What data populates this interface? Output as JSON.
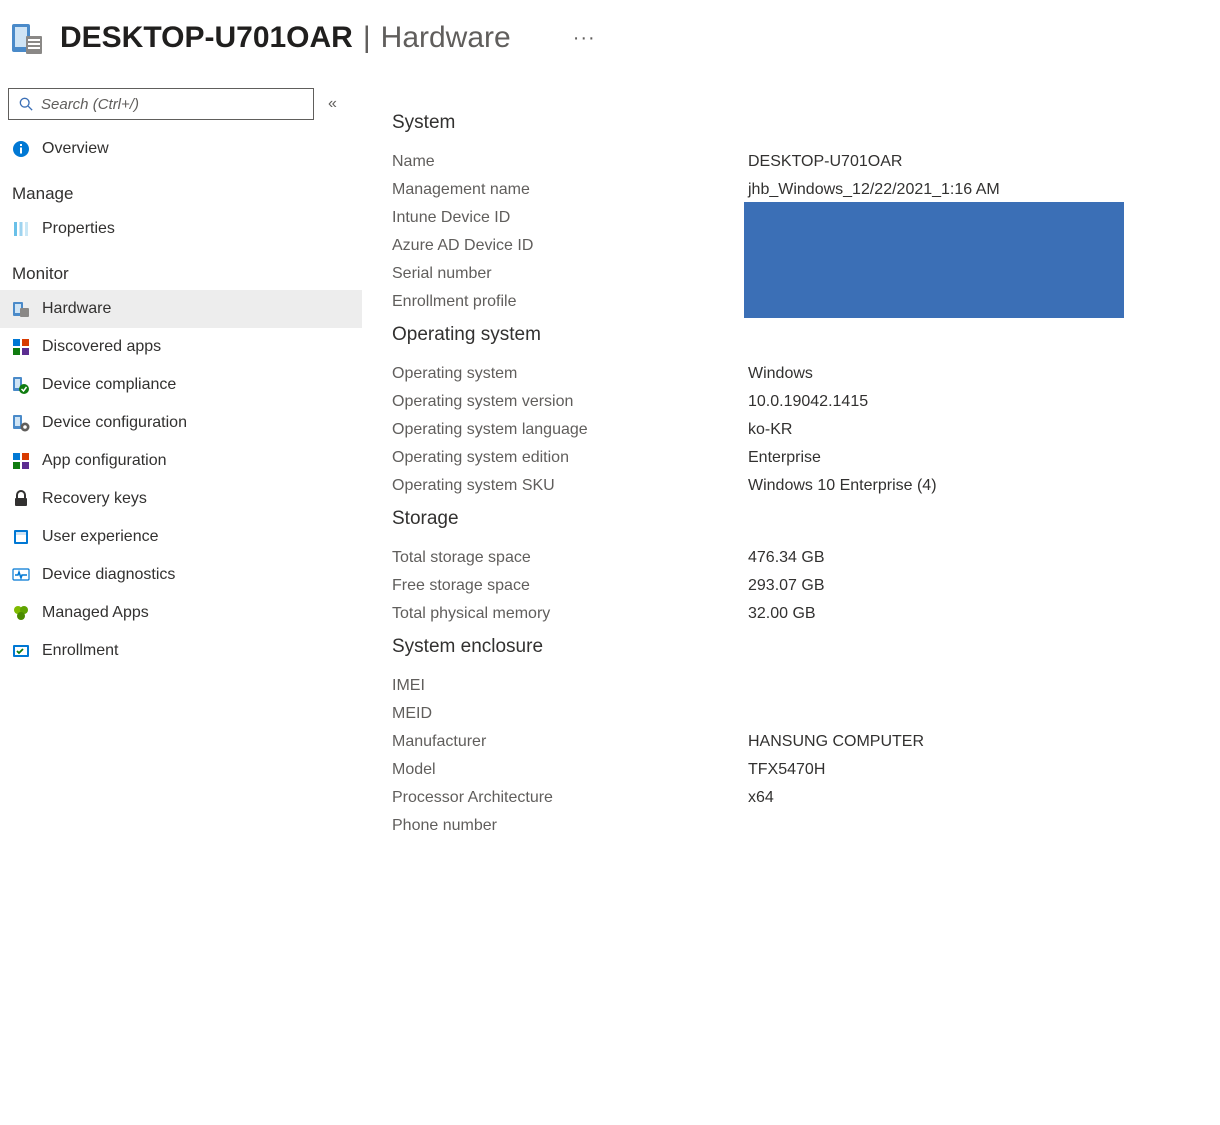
{
  "header": {
    "device_name": "DESKTOP-U701OAR",
    "separator": "|",
    "page": "Hardware",
    "more": "···"
  },
  "sidebar": {
    "search_placeholder": "Search (Ctrl+/)",
    "collapse_glyph": "«",
    "items": {
      "overview": "Overview",
      "manage_section": "Manage",
      "properties": "Properties",
      "monitor_section": "Monitor",
      "hardware": "Hardware",
      "discovered_apps": "Discovered apps",
      "device_compliance": "Device compliance",
      "device_configuration": "Device configuration",
      "app_configuration": "App configuration",
      "recovery_keys": "Recovery keys",
      "user_experience": "User experience",
      "device_diagnostics": "Device diagnostics",
      "managed_apps": "Managed Apps",
      "enrollment": "Enrollment"
    }
  },
  "main": {
    "headings": {
      "system": "System",
      "os": "Operating system",
      "storage": "Storage",
      "enclosure": "System enclosure"
    },
    "system": {
      "name_label": "Name",
      "name_value": "DESKTOP-U701OAR",
      "mgmt_label": "Management name",
      "mgmt_value": "jhb_Windows_12/22/2021_1:16 AM",
      "intune_label": "Intune Device ID",
      "intune_value": "",
      "aad_label": "Azure AD Device ID",
      "aad_value": "",
      "serial_label": "Serial number",
      "serial_value": "",
      "enroll_label": "Enrollment profile",
      "enroll_value": ""
    },
    "os": {
      "os_label": "Operating system",
      "os_value": "Windows",
      "ver_label": "Operating system version",
      "ver_value": "10.0.19042.1415",
      "lang_label": "Operating system language",
      "lang_value": "ko-KR",
      "ed_label": "Operating system edition",
      "ed_value": "Enterprise",
      "sku_label": "Operating system SKU",
      "sku_value": "Windows 10 Enterprise (4)"
    },
    "storage": {
      "total_label": "Total storage space",
      "total_value": "476.34 GB",
      "free_label": "Free storage space",
      "free_value": "293.07 GB",
      "mem_label": "Total physical memory",
      "mem_value": "32.00 GB"
    },
    "enclosure": {
      "imei_label": "IMEI",
      "imei_value": "",
      "meid_label": "MEID",
      "meid_value": "",
      "mfr_label": "Manufacturer",
      "mfr_value": "HANSUNG COMPUTER",
      "model_label": "Model",
      "model_value": "TFX5470H",
      "arch_label": "Processor Architecture",
      "arch_value": "x64",
      "phone_label": "Phone number",
      "phone_value": ""
    }
  }
}
